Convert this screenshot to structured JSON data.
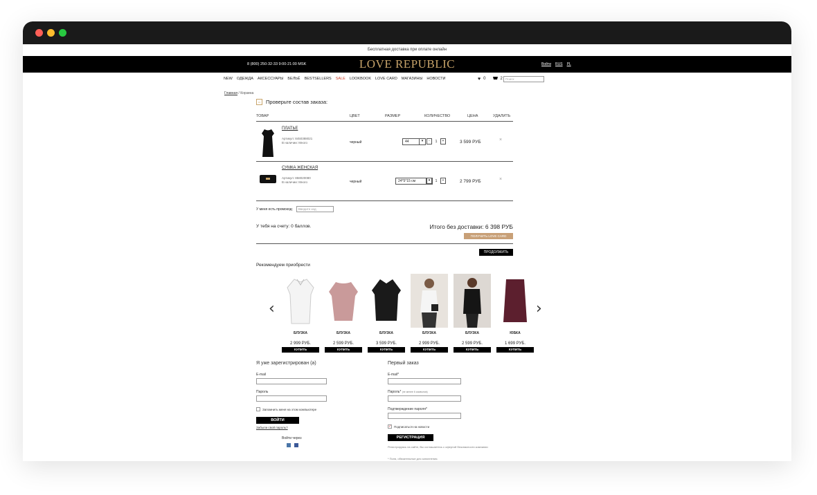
{
  "promo_text": "Бесплатная доставка при оплате онлайн",
  "header": {
    "phone": "8 (800) 250-32-33 9:00-21:00 MSK",
    "logo": "LOVE REPUBLIC",
    "langs": [
      "Войти",
      "RUS",
      "PL"
    ]
  },
  "nav": [
    "NEW",
    "ОДЕЖДА",
    "АКСЕССУАРЫ",
    "БЕЛЬЁ",
    "BESTSELLERS",
    "SALE",
    "LOOKBOOK",
    "LOVE CARD",
    "МАГАЗИНЫ",
    "НОВОСТИ"
  ],
  "wishlist_count": "0",
  "cart_count": "2",
  "search_placeholder": "Поиск",
  "breadcrumbs": [
    "Главная",
    "Корзина"
  ],
  "cart": {
    "title": "Проверьте состав заказа:",
    "columns": [
      "ТОВАР",
      "ЦВЕТ",
      "РАЗМЕР",
      "КОЛИЧЕСТВО",
      "ЦЕНА",
      "УДАЛИТЬ"
    ],
    "items": [
      {
        "name": "ПЛАТЬЕ",
        "article": "Артикул: 8450388021",
        "stock": "В наличии: Много",
        "color": "черный",
        "size": "44",
        "qty": "1",
        "price": "3 599 РУБ"
      },
      {
        "name": "СУМКА ЖЕНСКАЯ",
        "article": "Артикул: 858020080",
        "stock": "В наличии: Много",
        "color": "черный",
        "size": "24*5*15 см",
        "qty": "1",
        "price": "2 799 РУБ"
      }
    ],
    "promo_label": "У меня есть промокод:",
    "promo_placeholder": "Введите код",
    "balance": "У тебя на счету: 0 баллов.",
    "total": "Итого без доставки: 6 398 РУБ",
    "lovecard_btn": "ПОЛУЧИТЬ LOVE CARD",
    "continue_btn": "ПРОДОЛЖИТЬ"
  },
  "recommend": {
    "title": "Рекомендуем приобрести",
    "items": [
      {
        "name": "БЛУЗКА",
        "price": "2 999 РУБ.",
        "buy": "КУПИТЬ"
      },
      {
        "name": "БЛУЗКА",
        "price": "2 599 РУБ.",
        "buy": "КУПИТЬ"
      },
      {
        "name": "БЛУЗКА",
        "price": "3 599 РУБ.",
        "buy": "КУПИТЬ"
      },
      {
        "name": "БЛУЗКА",
        "price": "2 999 РУБ.",
        "buy": "КУПИТЬ"
      },
      {
        "name": "БЛУЗКА",
        "price": "2 599 РУБ.",
        "buy": "КУПИТЬ"
      },
      {
        "name": "ЮБКА",
        "price": "1 699 РУБ.",
        "buy": "КУПИТЬ"
      }
    ]
  },
  "login": {
    "title": "Я уже зарегистрирован (а)",
    "email_label": "E-mail",
    "password_label": "Пароль",
    "remember": "Запомнить меня на этом компьютере",
    "button": "ВОЙТИ",
    "forgot": "Забыли свой пароль?",
    "via": "Войти через"
  },
  "register": {
    "title": "Первый заказ",
    "email_label": "E-mail*",
    "password_label": "Пароль*",
    "password_hint": "(не менее 6 символов)",
    "confirm_label": "Подтверждение пароля*",
    "subscribe": "Подписаться на новости",
    "button": "РЕГИСТРАЦИЯ",
    "agreement": "Регистрируясь на сайте, Вы соглашаетесь с офертой безопасности компании",
    "required_note": "* Поля, обязательные для заполнения."
  },
  "colors": {
    "accent": "#c8a46a",
    "sale": "#d0402a",
    "lovecard": "#c8a077"
  }
}
